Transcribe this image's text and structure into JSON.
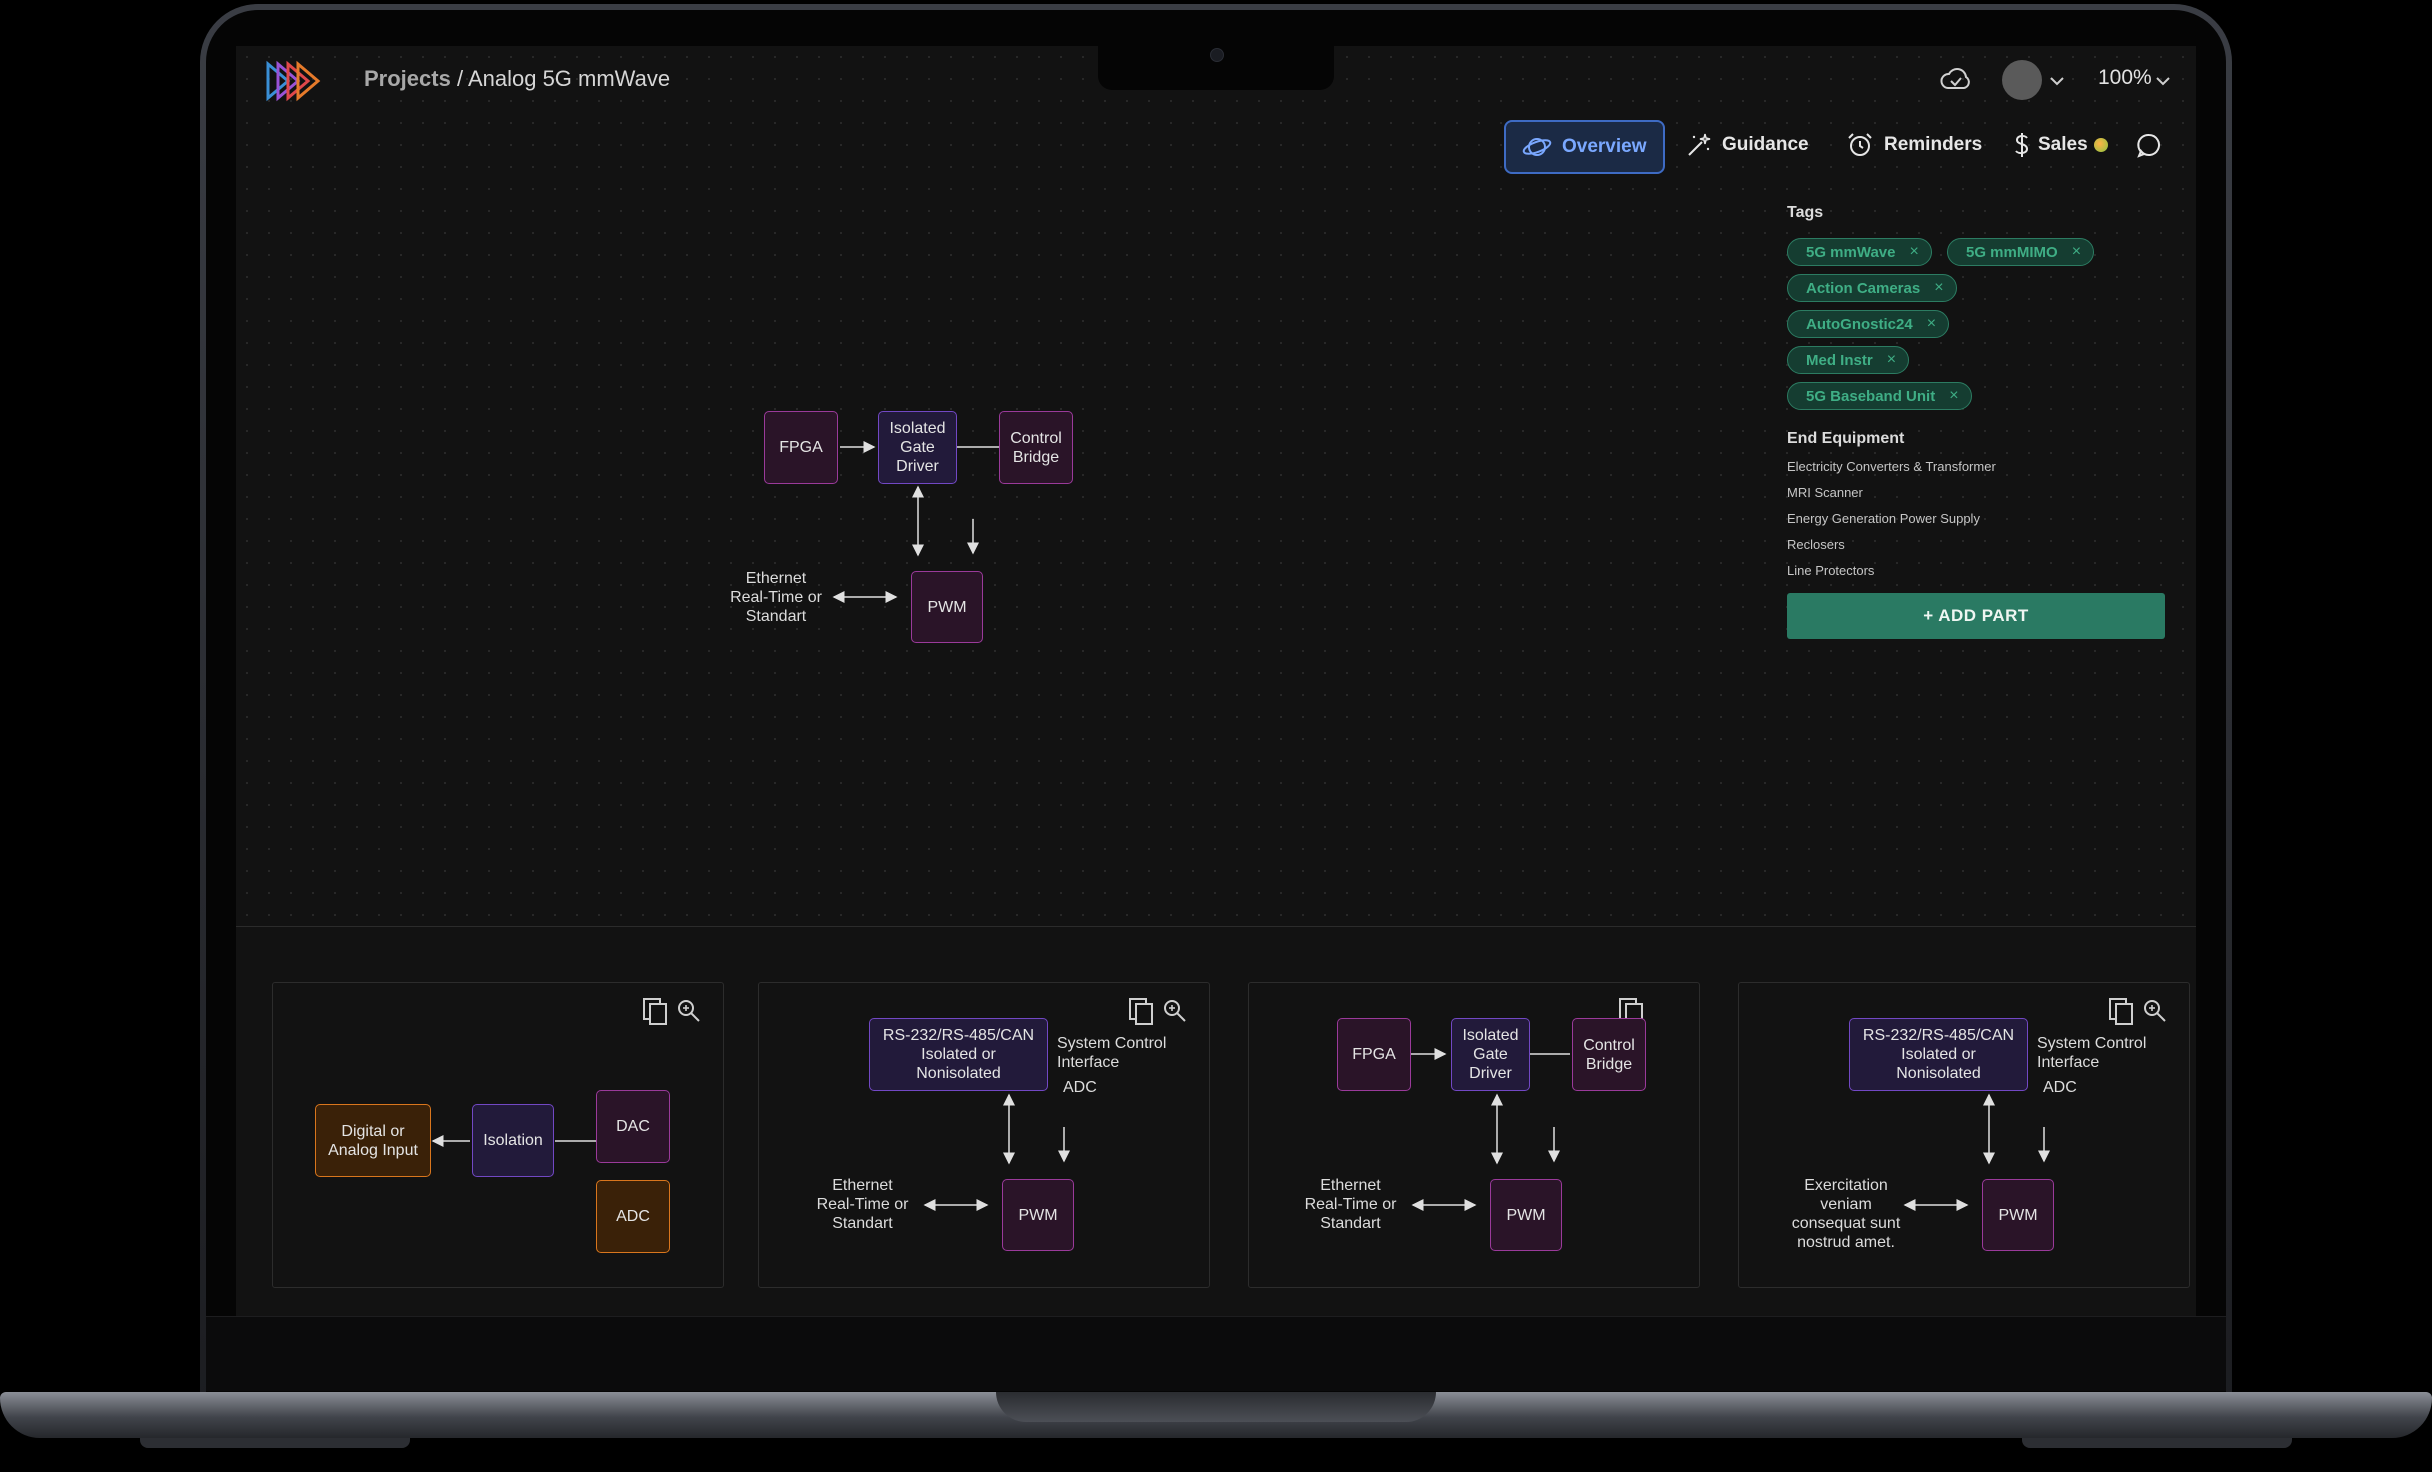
{
  "header": {
    "breadcrumb_root": "Projects",
    "breadcrumb_sep": " / ",
    "breadcrumb_current": "Analog 5G mmWave",
    "zoom": "100%"
  },
  "nav": {
    "overview": "Overview",
    "guidance": "Guidance",
    "reminders": "Reminders",
    "sales": "Sales"
  },
  "colors": {
    "accent_blue": "#3e6bc4",
    "tag_green": "#3fae85",
    "add_part_bg": "#2a7a63",
    "node_pink": "#9a3a9a",
    "node_purple": "#7248c4",
    "node_orange": "#d9761d"
  },
  "panel": {
    "tags_title": "Tags",
    "tags": [
      "5G mmWave",
      "5G mmMIMO",
      "Action Cameras",
      "AutoGnostic24",
      "Med Instr",
      "5G Baseband Unit"
    ],
    "tag_remove": "×",
    "end_equipment_title": "End Equipment",
    "end_equipment": [
      "Electricity Converters & Transformer",
      "MRI Scanner",
      "Energy Generation Power Supply",
      "Reclosers",
      "Line Protectors"
    ],
    "add_part": "+ ADD PART"
  },
  "main_diagram": {
    "fpga": "FPGA",
    "gate_driver": "Isolated\nGate\nDriver",
    "control_bridge": "Control\nBridge",
    "pwm": "PWM",
    "ethernet": "Ethernet\nReal-Time or\nStandart"
  },
  "cards": [
    {
      "nodes": {
        "digital": "Digital or\nAnalog Input",
        "isolation": "Isolation",
        "dac": "DAC",
        "adc": "ADC"
      }
    },
    {
      "nodes": {
        "rs": "RS-232/RS-485/CAN\nIsolated or\nNonisolated",
        "pwm": "PWM"
      },
      "labels": {
        "sys": "System Control\nInterface",
        "adc": "ADC",
        "eth": "Ethernet\nReal-Time or\nStandart"
      }
    },
    {
      "nodes": {
        "fpga": "FPGA",
        "gate": "Isolated\nGate\nDriver",
        "bridge": "Control\nBridge",
        "pwm": "PWM"
      },
      "labels": {
        "eth": "Ethernet\nReal-Time or\nStandart"
      }
    },
    {
      "nodes": {
        "rs": "RS-232/RS-485/CAN\nIsolated or\nNonisolated",
        "pwm": "PWM"
      },
      "labels": {
        "sys": "System Control\nInterface",
        "adc": "ADC",
        "exer": "Exercitation\nveniam\nconsequat sunt\nnostrud amet."
      }
    }
  ]
}
